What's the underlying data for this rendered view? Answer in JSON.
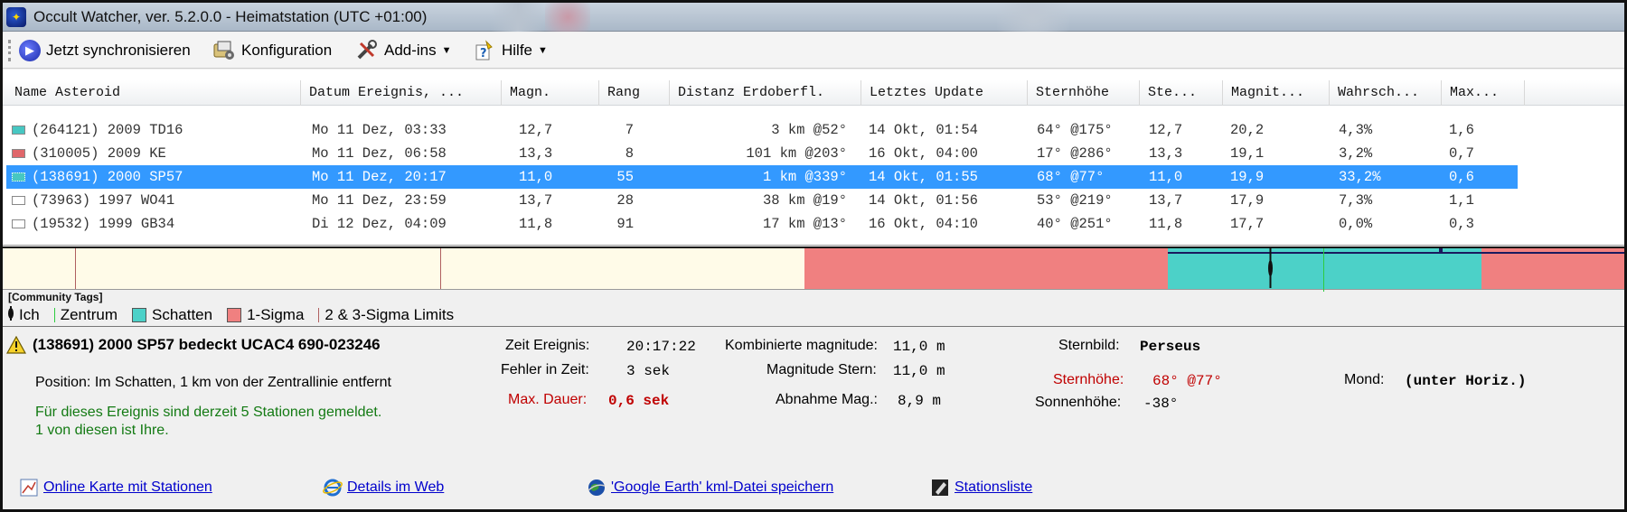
{
  "window": {
    "title": "Occult Watcher, ver. 5.2.0.0 - Heimatstation (UTC +01:00)",
    "app_icon": "star-icon"
  },
  "toolbar": {
    "sync_label": "Jetzt synchronisieren",
    "config_label": "Konfiguration",
    "addins_label": "Add-ins",
    "help_label": "Hilfe"
  },
  "grid": {
    "columns": [
      "Name Asteroid",
      "Datum Ereignis, ...",
      "Magn.",
      "Rang",
      "Distanz Erdoberfl.",
      "Letztes Update",
      "Sternhöhe",
      "Ste...",
      "Magnit...",
      "Wahrsch...",
      "Max..."
    ],
    "rows": [
      {
        "swatch": "#47c7c2",
        "name": "(264121) 2009 TD16",
        "date": "Mo 11 Dez, 03:33",
        "magn": "12,7",
        "rank": "7",
        "dist": "3 km @52°",
        "update": "14 Okt, 01:54",
        "alt": "64° @175°",
        "ste": "12,7",
        "magnit": "20,2",
        "prob": "4,3%",
        "max": "1,6",
        "selected": false
      },
      {
        "swatch": "#e0676b",
        "name": "(310005) 2009 KE",
        "date": "Mo 11 Dez, 06:58",
        "magn": "13,3",
        "rank": "8",
        "dist": "101 km @203°",
        "update": "16 Okt, 04:00",
        "alt": "17° @286°",
        "ste": "13,3",
        "magnit": "19,1",
        "prob": "3,2%",
        "max": "0,7",
        "selected": false
      },
      {
        "swatch": "#47c7c2",
        "name": "(138691) 2000 SP57",
        "date": "Mo 11 Dez, 20:17",
        "magn": "11,0",
        "rank": "55",
        "dist": "1 km @339°",
        "update": "14 Okt, 01:55",
        "alt": "68° @77°",
        "ste": "11,0",
        "magnit": "19,9",
        "prob": "33,2%",
        "max": "0,6",
        "selected": true
      },
      {
        "swatch": "#ffffff",
        "name": " (73963) 1997 WO41",
        "date": "Mo 11 Dez, 23:59",
        "magn": "13,7",
        "rank": "28",
        "dist": "38 km @19°",
        "update": "14 Okt, 01:56",
        "alt": "53° @219°",
        "ste": "13,7",
        "magnit": "17,9",
        "prob": "7,3%",
        "max": "1,1",
        "selected": false
      },
      {
        "swatch": "#ffffff",
        "name": " (19532) 1999 GB34",
        "date": "Di 12 Dez, 04:09",
        "magn": "11,8",
        "rank": "91",
        "dist": "17 km @13°",
        "update": "16 Okt, 04:10",
        "alt": "40° @251°",
        "ste": "11,8",
        "magnit": "17,7",
        "prob": "0,0%",
        "max": "0,3",
        "selected": false
      }
    ]
  },
  "band_colors": {
    "one_sigma": "#f08080",
    "shadow": "#4cd1c8",
    "band_bg": "#fffbe8"
  },
  "legend": {
    "title": "[Community Tags]",
    "me": "Ich",
    "center": "Zentrum",
    "shadow": "Schatten",
    "one_sigma": "1-Sigma",
    "limits": "2 & 3-Sigma Limits"
  },
  "details": {
    "headline": "(138691) 2000 SP57 bedeckt  UCAC4 690-023246",
    "position": "Position:  Im Schatten, 1 km von der Zentrallinie entfernt",
    "stations_line1": "Für dieses Ereignis sind derzeit 5 Stationen gemeldet.",
    "stations_line2": "1 von diesen ist Ihre.",
    "event_time_label": "Zeit Ereignis:",
    "event_time_value": "20:17:22",
    "time_error_label": "Fehler in Zeit:",
    "time_error_value": "3 sek",
    "max_duration_label": "Max. Dauer:",
    "max_duration_value": "0,6 sek",
    "combined_mag_label": "Kombinierte magnitude:",
    "combined_mag_value": "11,0 m",
    "star_mag_label": "Magnitude Stern:",
    "star_mag_value": "11,0 m",
    "mag_drop_label": "Abnahme Mag.:",
    "mag_drop_value": "8,9 m",
    "constellation_label": "Sternbild:",
    "constellation_value": "Perseus",
    "star_alt_label": "Sternhöhe:",
    "star_alt_value": "68° @77°",
    "sun_alt_label": "Sonnenhöhe:",
    "sun_alt_value": "-38°",
    "moon_label": "Mond:",
    "moon_value": "(unter Horiz.)"
  },
  "links": {
    "map": "Online Karte mit Stationen",
    "web": "Details im Web",
    "kml": "'Google Earth' kml-Datei speichern",
    "stations": "Stationsliste"
  }
}
